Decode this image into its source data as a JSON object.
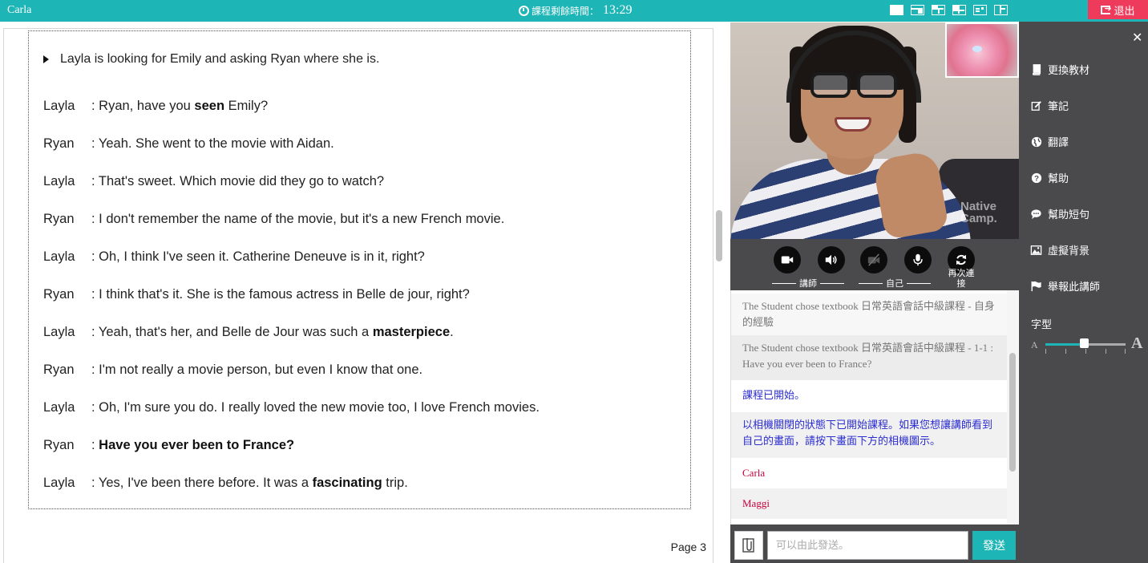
{
  "topbar": {
    "user": "Carla",
    "timer_label": "課程剩餘時間：",
    "timer_value": "13:29",
    "exit_label": "退出"
  },
  "document": {
    "intro": "Layla is looking for Emily and asking Ryan where she is.",
    "lines": [
      {
        "speaker": "Layla",
        "pre": ": Ryan, have you ",
        "bold": "seen",
        "post": " Emily?"
      },
      {
        "speaker": "Ryan",
        "pre": ": Yeah. She went to the movie with Aidan.",
        "bold": "",
        "post": ""
      },
      {
        "speaker": "Layla",
        "pre": ": That's sweet. Which movie did they go to watch?",
        "bold": "",
        "post": ""
      },
      {
        "speaker": "Ryan",
        "pre": ": I don't remember the name of the movie, but it's a new French movie.",
        "bold": "",
        "post": ""
      },
      {
        "speaker": "Layla",
        "pre": ": Oh, I think I've seen it. Catherine Deneuve is in it, right?",
        "bold": "",
        "post": ""
      },
      {
        "speaker": "Ryan",
        "pre": ": I think that's it. She is the famous actress in Belle de jour, right?",
        "bold": "",
        "post": ""
      },
      {
        "speaker": "Layla",
        "pre": ": Yeah, that's her, and Belle de Jour was such a ",
        "bold": "masterpiece",
        "post": "."
      },
      {
        "speaker": "Ryan",
        "pre": ": I'm not really a movie person, but even I know that one.",
        "bold": "",
        "post": ""
      },
      {
        "speaker": "Layla",
        "pre": ": Oh, I'm sure you do. I really loved the new movie too, I love French movies.",
        "bold": "",
        "post": ""
      },
      {
        "speaker": "Ryan",
        "pre": ": ",
        "bold": "Have you ever been to France?",
        "post": ""
      },
      {
        "speaker": "Layla",
        "pre": ": Yes, I've been there before. It was a ",
        "bold": "fascinating",
        "post": " trip."
      }
    ],
    "page": "Page 3"
  },
  "video": {
    "watermark_line1": "Native",
    "watermark_line2": "Camp."
  },
  "controls": {
    "teacher_label": "講師",
    "self_label": "自己",
    "retry_label": "再次連接"
  },
  "chat": {
    "messages": [
      {
        "text": "The Student chose textbook 日常英語會話中級課程 - 自身的經驗",
        "style": "sys"
      },
      {
        "text": "The Student chose textbook 日常英語會話中級課程 - 1-1 : Have you ever been to France?",
        "style": "sys"
      },
      {
        "text": "課程已開始。",
        "style": "blue"
      },
      {
        "text": "以相機關閉的狀態下已開始課程。如果您想讓講師看到自己的畫面，請按下畫面下方的相機圖示。",
        "style": "blue"
      },
      {
        "text": "Carla",
        "style": "red"
      },
      {
        "text": "Maggi",
        "style": "red"
      }
    ],
    "input_placeholder": "可以由此發送。",
    "send_label": "發送"
  },
  "side": {
    "items": [
      {
        "label": "更換教材",
        "icon": "book-icon"
      },
      {
        "label": "筆記",
        "icon": "edit-icon"
      },
      {
        "label": "翻譯",
        "icon": "globe-icon"
      },
      {
        "label": "幫助",
        "icon": "help-icon"
      },
      {
        "label": "幫助短句",
        "icon": "speech-bubble-icon"
      },
      {
        "label": "虛擬背景",
        "icon": "image-icon"
      },
      {
        "label": "舉報此講師",
        "icon": "flag-icon"
      }
    ],
    "font_label": "字型",
    "font_small": "A",
    "font_big": "A",
    "font_level": 0.48
  },
  "colors": {
    "teal": "#1db5b5",
    "exit_red": "#ee3b5b",
    "panel_dark": "#4a4a4c",
    "chat_blue": "#2c2dcf",
    "chat_red": "#c8003c"
  }
}
